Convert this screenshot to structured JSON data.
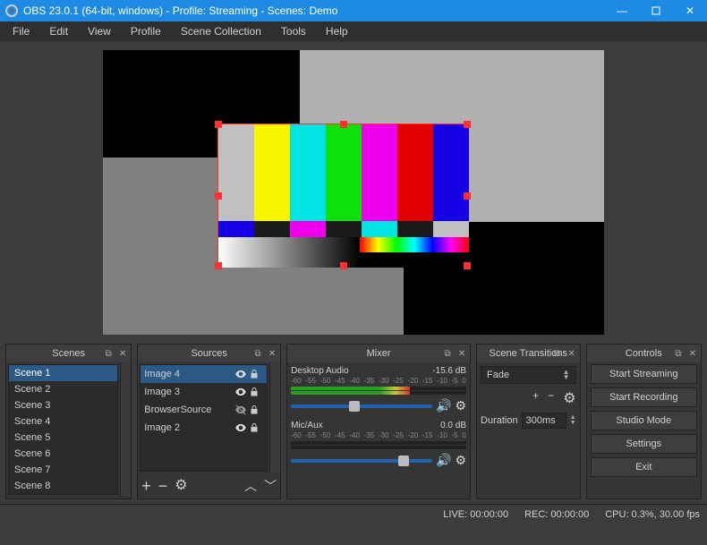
{
  "titlebar": {
    "text": "OBS 23.0.1 (64-bit, windows) - Profile: Streaming - Scenes: Demo"
  },
  "menu": {
    "items": [
      "File",
      "Edit",
      "View",
      "Profile",
      "Scene Collection",
      "Tools",
      "Help"
    ]
  },
  "panels": {
    "scenes": "Scenes",
    "sources": "Sources",
    "mixer": "Mixer",
    "transitions": "Scene Transitions",
    "controls": "Controls"
  },
  "scenes": {
    "items": [
      "Scene 1",
      "Scene 2",
      "Scene 3",
      "Scene 4",
      "Scene 5",
      "Scene 6",
      "Scene 7",
      "Scene 8"
    ],
    "selected": 0
  },
  "sources": {
    "items": [
      {
        "name": "Image 4",
        "visible": true,
        "locked": true,
        "selected": true
      },
      {
        "name": "Image 3",
        "visible": true,
        "locked": true,
        "selected": false
      },
      {
        "name": "BrowserSource",
        "visible": false,
        "locked": true,
        "selected": false
      },
      {
        "name": "Image 2",
        "visible": true,
        "locked": true,
        "selected": false
      }
    ]
  },
  "mixer": {
    "channels": [
      {
        "name": "Desktop Audio",
        "db": "-15.6 dB",
        "level_pct": 68,
        "slider_pct": 45
      },
      {
        "name": "Mic/Aux",
        "db": "0.0 dB",
        "level_pct": 0,
        "slider_pct": 80
      }
    ],
    "ticks": [
      "-60",
      "-55",
      "-50",
      "-45",
      "-40",
      "-35",
      "-30",
      "-25",
      "-20",
      "-15",
      "-10",
      "-5",
      "0"
    ]
  },
  "transitions": {
    "current": "Fade",
    "duration_label": "Duration",
    "duration_value": "300ms"
  },
  "controls": {
    "buttons": [
      "Start Streaming",
      "Start Recording",
      "Studio Mode",
      "Settings",
      "Exit"
    ]
  },
  "statusbar": {
    "live": "LIVE: 00:00:00",
    "rec": "REC: 00:00:00",
    "cpu": "CPU: 0.3%, 30.00 fps"
  },
  "icons": {
    "minimize": "—",
    "close": "✕"
  }
}
